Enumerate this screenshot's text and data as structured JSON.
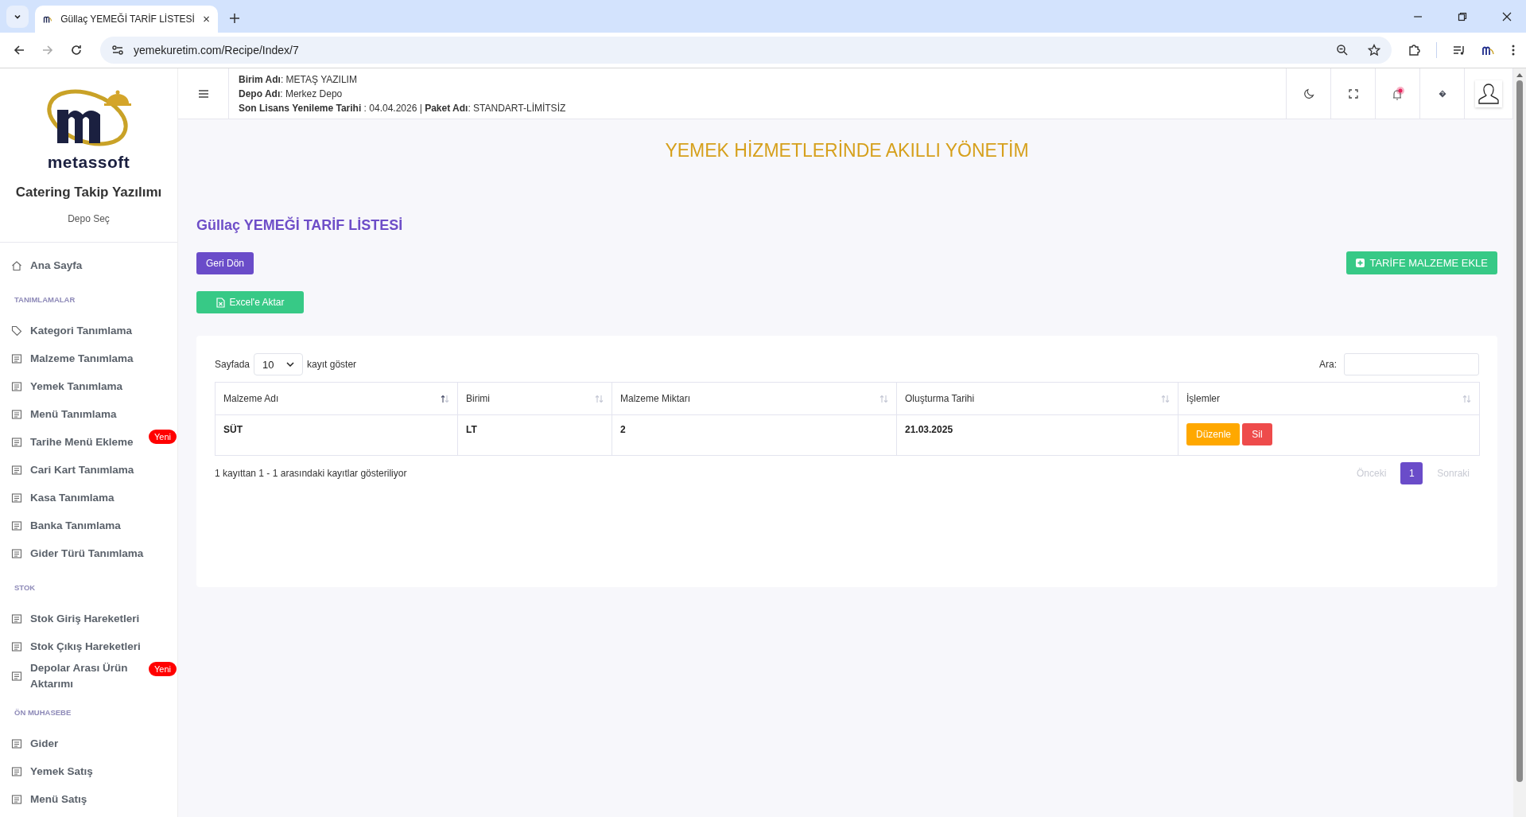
{
  "browser": {
    "tab_title": "Güllaç YEMEĞİ TARİF LİSTESİ",
    "url": "yemekuretim.com/Recipe/Index/7"
  },
  "sidebar": {
    "logo_text": "metassoft",
    "app_name": "Catering Takip Yazılımı",
    "depot_link": "Depo Seç",
    "items": [
      {
        "kind": "item",
        "label": "Ana Sayfa"
      },
      {
        "kind": "section",
        "label": "TANIMLAMALAR"
      },
      {
        "kind": "item",
        "label": "Kategori Tanımlama"
      },
      {
        "kind": "item",
        "label": "Malzeme Tanımlama"
      },
      {
        "kind": "item",
        "label": "Yemek Tanımlama"
      },
      {
        "kind": "item",
        "label": "Menü Tanımlama"
      },
      {
        "kind": "item",
        "label": "Tarihe Menü Ekleme",
        "badge": "Yeni"
      },
      {
        "kind": "item",
        "label": "Cari Kart Tanımlama"
      },
      {
        "kind": "item",
        "label": "Kasa Tanımlama"
      },
      {
        "kind": "item",
        "label": "Banka Tanımlama"
      },
      {
        "kind": "item",
        "label": "Gider Türü Tanımlama"
      },
      {
        "kind": "section",
        "label": "STOK"
      },
      {
        "kind": "item",
        "label": "Stok Giriş Hareketleri"
      },
      {
        "kind": "item",
        "label": "Stok Çıkış Hareketleri"
      },
      {
        "kind": "item",
        "label": "Depolar Arası Ürün Aktarımı",
        "badge": "Yeni"
      },
      {
        "kind": "section",
        "label": "ÖN MUHASEBE"
      },
      {
        "kind": "item",
        "label": "Gider"
      },
      {
        "kind": "item",
        "label": "Yemek Satış"
      },
      {
        "kind": "item",
        "label": "Menü Satış"
      }
    ]
  },
  "header": {
    "info_lines": [
      "**Birim Adı**: METAŞ YAZILIM",
      "**Depo Adı**: Merkez Depo",
      "**Son Lisans Yenileme Tarihi** : 04.04.2026 | **Paket Adı**: STANDART-LİMİTSİZ"
    ]
  },
  "page": {
    "banner": "YEMEK HİZMETLERİNDE AKILLI YÖNETİM",
    "title": "Güllaç YEMEĞİ TARİF LİSTESİ",
    "back_button": "Geri Dön",
    "add_button": "TARİFE MALZEME EKLE",
    "excel_button": "Excel'e Aktar"
  },
  "table": {
    "length_prefix": "Sayfada",
    "length_value": "10",
    "length_suffix": "kayıt göster",
    "search_label": "Ara:",
    "columns": [
      {
        "label": "Malzeme Adı",
        "sorted": true
      },
      {
        "label": "Birimi",
        "sorted": false
      },
      {
        "label": "Malzeme Miktarı",
        "sorted": false
      },
      {
        "label": "Oluşturma Tarihi",
        "sorted": false
      },
      {
        "label": "İşlemler",
        "sorted": false
      }
    ],
    "rows": [
      {
        "cells": [
          "SÜT",
          "LT",
          "2",
          "21.03.2025"
        ],
        "actions": [
          {
            "kind": "edit",
            "label": "Düzenle"
          },
          {
            "kind": "delete",
            "label": "Sil"
          }
        ]
      }
    ],
    "info": "1 kayıttan 1 - 1 arasındaki kayıtlar gösteriliyor",
    "pagination": {
      "previous": {
        "label": "Önceki",
        "disabled": true
      },
      "pages": [
        {
          "label": "1",
          "selected": true
        }
      ],
      "next": {
        "label": "Sonraki",
        "disabled": true
      }
    }
  }
}
